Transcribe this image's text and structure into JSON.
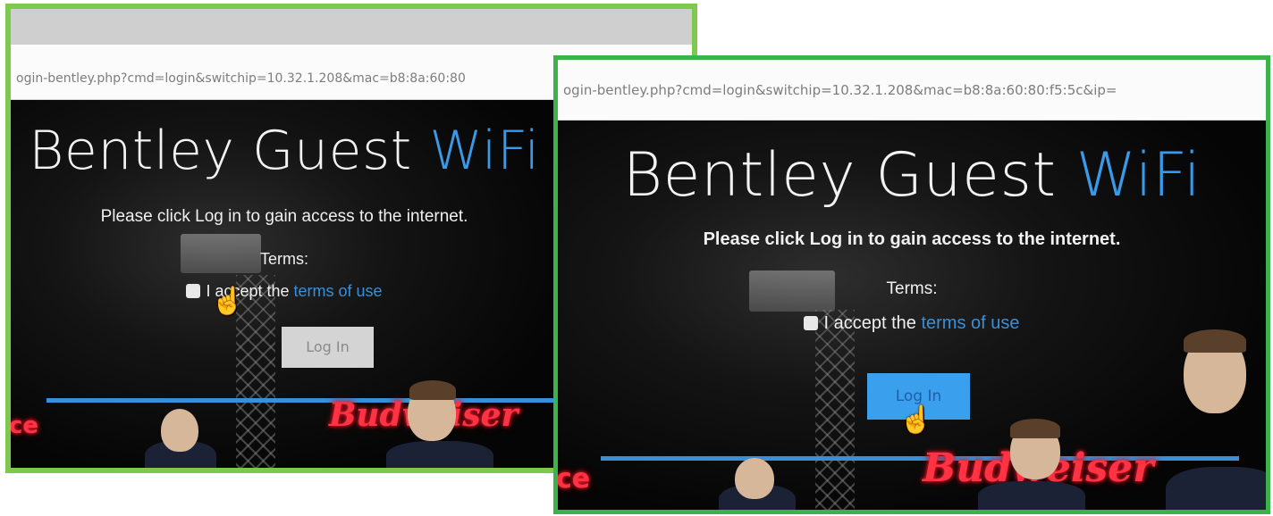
{
  "left_window": {
    "url": "ogin-bentley.php?cmd=login&switchip=10.32.1.208&mac=b8:8a:60:80",
    "title_main": "Bentley Guest ",
    "title_accent": "WiFi",
    "subtitle": "Please click Log in to gain access to the internet.",
    "terms_label": "Terms:",
    "accept_prefix": "I accept the ",
    "terms_link": "terms of use",
    "login_label": "Log In",
    "login_state": "disabled",
    "banner_text": "Budweiser",
    "partial_sign": "ce"
  },
  "right_window": {
    "url": "ogin-bentley.php?cmd=login&switchip=10.32.1.208&mac=b8:8a:60:80:f5:5c&ip=",
    "title_main": "Bentley Guest ",
    "title_accent": "WiFi",
    "subtitle": "Please click Log in to gain access to the internet.",
    "terms_label": "Terms:",
    "accept_prefix": "I accept the ",
    "terms_link": "terms of use",
    "login_label": "Log In",
    "login_state": "enabled",
    "banner_text": "Budweiser",
    "partial_sign": "ce"
  },
  "colors": {
    "left_border": "#7ec850",
    "right_border": "#3cb34a",
    "accent_blue": "#3a99e8",
    "link_blue": "#3a8fd6",
    "button_disabled": "#d4d4d4",
    "button_enabled": "#3aa0ee"
  },
  "icons": [
    "hand-cursor-icon",
    "checkbox-icon"
  ]
}
